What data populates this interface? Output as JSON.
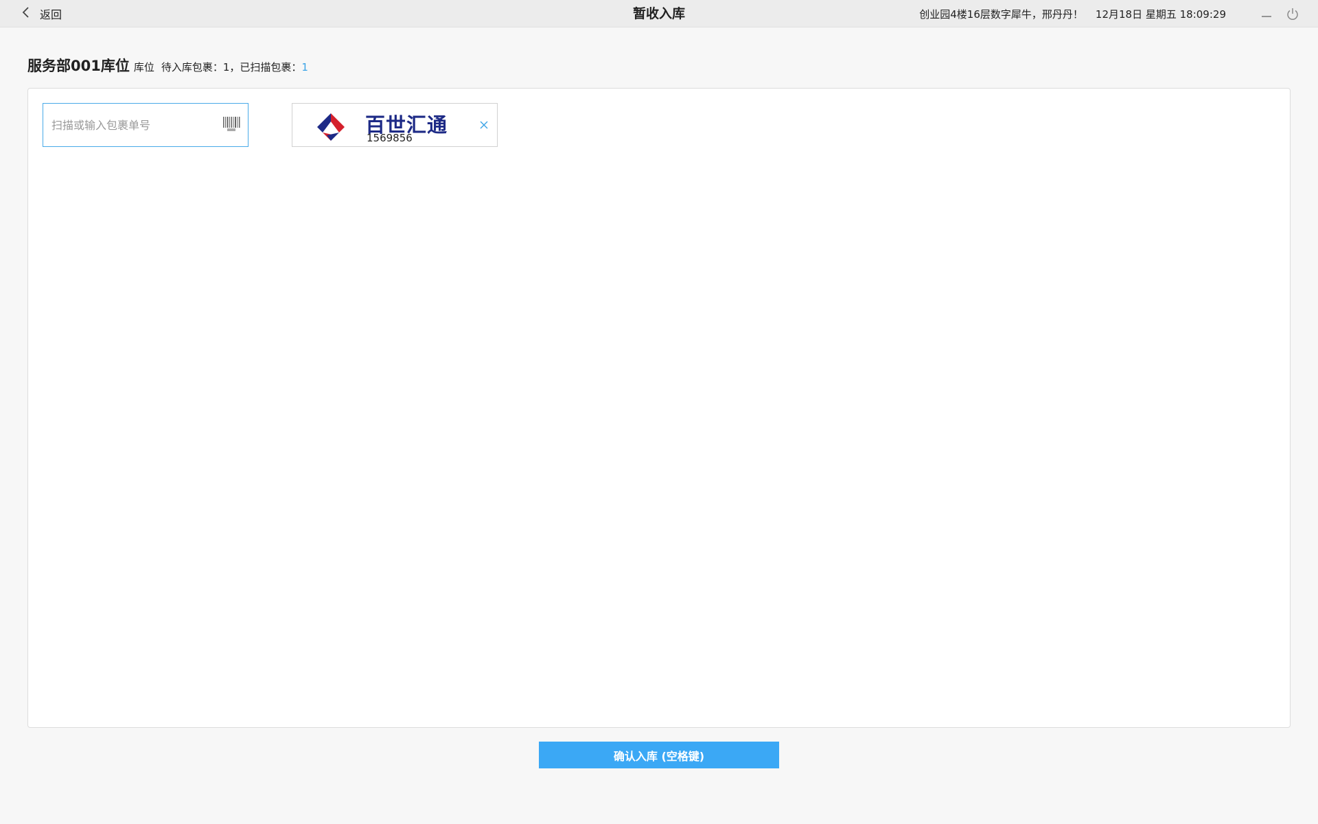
{
  "topbar": {
    "back_label": "返回",
    "title": "暂收入库",
    "greeting": "创业园4楼16层数字犀牛，邢丹丹！",
    "datetime": "12月18日 星期五 18:09:29",
    "icons": {
      "back": "chevron-left-icon",
      "minimize": "minimize-icon",
      "power": "power-icon"
    }
  },
  "header": {
    "location_name": "服务部001库位",
    "location_suffix": "库位",
    "pending_text": "待入库包裹：1，已扫描包裹：",
    "scanned_count": "1"
  },
  "scan": {
    "placeholder": "扫描或输入包裹单号",
    "value": "",
    "icon": "barcode-icon"
  },
  "packages": [
    {
      "carrier": "百世汇通",
      "number": "1569856",
      "remove_icon": "close-icon"
    }
  ],
  "confirm": {
    "label": "确认入库 (空格键)"
  },
  "colors": {
    "accent": "#3ba8f5",
    "link": "#3aa3e6",
    "carrier_blue": "#1d2a86",
    "carrier_red": "#d4202c"
  }
}
